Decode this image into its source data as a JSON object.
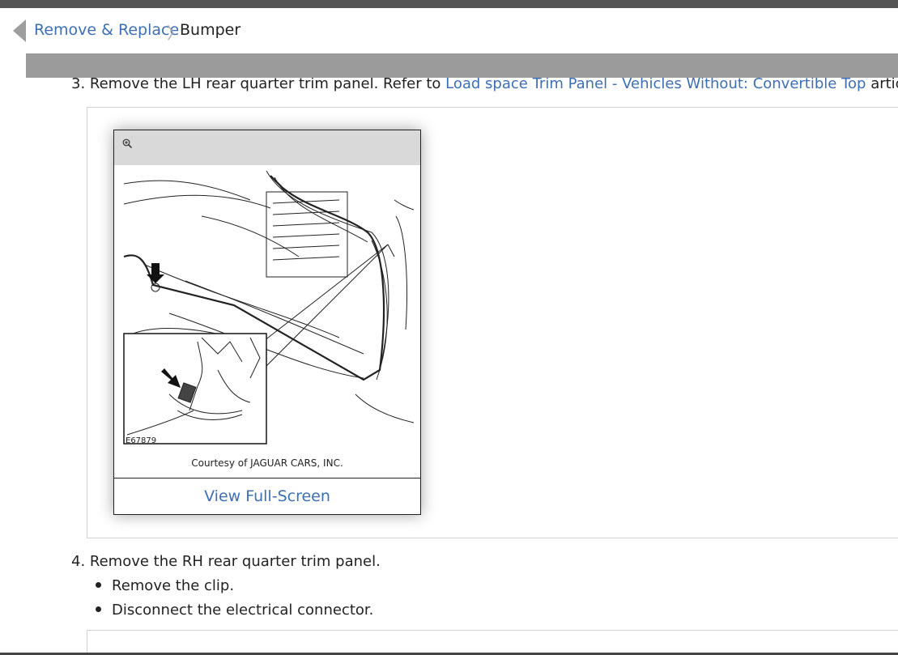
{
  "breadcrumb": {
    "parent": "Remove & Replace",
    "current": "Bumper"
  },
  "steps": {
    "step3": {
      "prefix": "3. Remove the LH rear quarter trim panel. Refer to ",
      "link": "Load space Trim Panel - Vehicles Without: Convertible Top",
      "suffix": " article."
    },
    "step4": {
      "text": "4. Remove the RH rear quarter trim panel.",
      "bullets": [
        "Remove the clip.",
        "Disconnect the electrical connector."
      ]
    }
  },
  "figure": {
    "image_label": "E67879",
    "courtesy": "Courtesy of JAGUAR CARS, INC.",
    "fullscreen_label": "View Full-Screen"
  },
  "icons": {
    "back": "chevron-left-icon",
    "zoom": "zoom-in-icon"
  },
  "colors": {
    "link": "#3d6fb4",
    "header_bar": "#9b9b9b",
    "top_strip": "#555555"
  }
}
